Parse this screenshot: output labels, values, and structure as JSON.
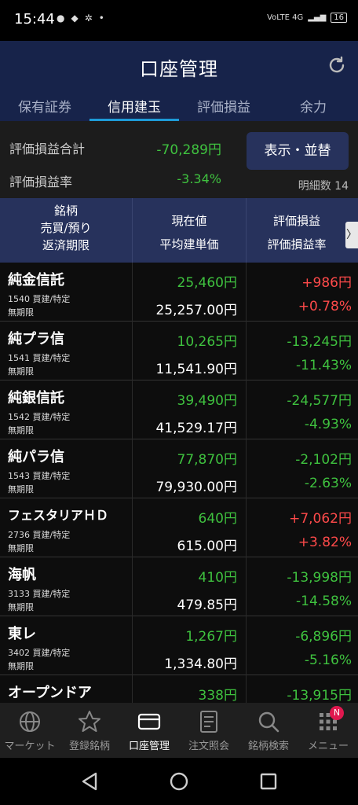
{
  "status_bar": {
    "time": "15:44",
    "left_icons": [
      "line-icon",
      "chat-icon",
      "ar-icon",
      "dot-icon"
    ],
    "network": "VoLTE 4G",
    "battery": "16"
  },
  "header": {
    "title": "口座管理",
    "refresh_icon": "refresh-icon"
  },
  "tabs": [
    {
      "label": "保有証券",
      "active": false
    },
    {
      "label": "信用建玉",
      "active": true
    },
    {
      "label": "評価損益",
      "active": false
    },
    {
      "label": "余力",
      "active": false
    }
  ],
  "summary": {
    "total_label": "評価損益合計",
    "total_value": "-70,289円",
    "rate_label": "評価損益率",
    "rate_value": "-3.34%",
    "display_button": "表示・並替",
    "detail_count": "明細数 14"
  },
  "table_header": {
    "col1_line1": "銘柄",
    "col1_line2": "売買/預り",
    "col1_line3": "返済期限",
    "col2_line1": "現在値",
    "col2_line2": "平均建単価",
    "col3_line1": "評価損益",
    "col3_line2": "評価損益率",
    "more": "〉"
  },
  "rows": [
    {
      "name": "純金信託",
      "sub": "1540 買建/特定",
      "expiry": "無期限",
      "price": "25,460円",
      "avg": "25,257.00円",
      "pl": "+986円",
      "rate": "+0.78%",
      "pl_color": "red"
    },
    {
      "name": "純プラ信",
      "sub": "1541 買建/特定",
      "expiry": "無期限",
      "price": "10,265円",
      "avg": "11,541.90円",
      "pl": "-13,245円",
      "rate": "-11.43%",
      "pl_color": "green"
    },
    {
      "name": "純銀信託",
      "sub": "1542 買建/特定",
      "expiry": "無期限",
      "price": "39,490円",
      "avg": "41,529.17円",
      "pl": "-24,577円",
      "rate": "-4.93%",
      "pl_color": "green"
    },
    {
      "name": "純パラ信",
      "sub": "1543 買建/特定",
      "expiry": "無期限",
      "price": "77,870円",
      "avg": "79,930.00円",
      "pl": "-2,102円",
      "rate": "-2.63%",
      "pl_color": "green"
    },
    {
      "name": "フェスタリアＨＤ",
      "sub": "2736 買建/特定",
      "expiry": "無期限",
      "price": "640円",
      "avg": "615.00円",
      "pl": "+7,062円",
      "rate": "+3.82%",
      "pl_color": "red"
    },
    {
      "name": "海帆",
      "sub": "3133 買建/特定",
      "expiry": "無期限",
      "price": "410円",
      "avg": "479.85円",
      "pl": "-13,998円",
      "rate": "-14.58%",
      "pl_color": "green"
    },
    {
      "name": "東レ",
      "sub": "3402 買建/特定",
      "expiry": "無期限",
      "price": "1,267円",
      "avg": "1,334.80円",
      "pl": "-6,896円",
      "rate": "-5.16%",
      "pl_color": "green"
    },
    {
      "name": "オープンドア",
      "sub": "",
      "expiry": "",
      "price": "338円",
      "avg": "",
      "pl": "-13,915円",
      "rate": "",
      "pl_color": "green"
    }
  ],
  "bottom_nav": [
    {
      "label": "マーケット",
      "icon": "globe-icon",
      "active": false
    },
    {
      "label": "登録銘柄",
      "icon": "star-icon",
      "active": false
    },
    {
      "label": "口座管理",
      "icon": "card-icon",
      "active": true
    },
    {
      "label": "注文照会",
      "icon": "document-icon",
      "active": false
    },
    {
      "label": "銘柄検索",
      "icon": "search-icon",
      "active": false
    },
    {
      "label": "メニュー",
      "icon": "grid-icon",
      "active": false,
      "badge": "N"
    }
  ],
  "colors": {
    "header_bg": "#17234a",
    "tab_underline": "#1e9bd7",
    "positive": "#ff4a4a",
    "negative": "#3fc23f"
  }
}
